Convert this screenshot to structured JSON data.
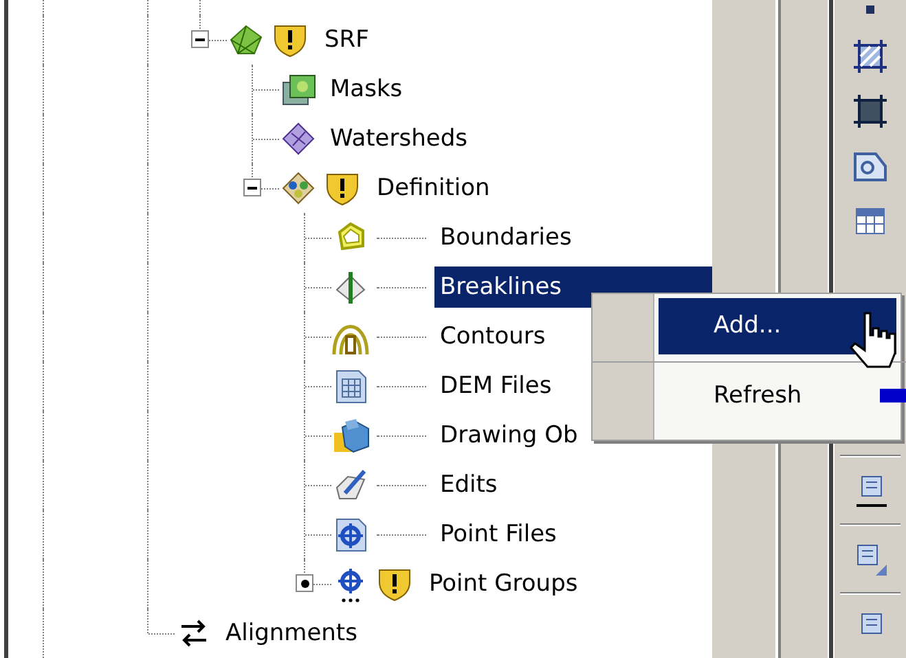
{
  "tree": [
    {
      "expanded": true,
      "children": [
        {
          "label": "SRF",
          "expanded": true,
          "warning": true,
          "selected": false,
          "children": [
            {
              "label": "Masks",
              "warning": false,
              "selected": false
            },
            {
              "label": "Watersheds",
              "warning": false,
              "selected": false
            },
            {
              "label": "Definition",
              "expanded": true,
              "warning": true,
              "selected": false,
              "children": [
                {
                  "label": "Boundaries",
                  "warning": false,
                  "selected": false
                },
                {
                  "label": "Breaklines",
                  "warning": false,
                  "selected": true
                },
                {
                  "label": "Contours",
                  "warning": false,
                  "selected": false
                },
                {
                  "label": "DEM Files",
                  "warning": false,
                  "selected": false
                },
                {
                  "label": "Drawing Ob",
                  "warning": false,
                  "selected": false
                },
                {
                  "label": "Edits",
                  "warning": false,
                  "selected": false
                },
                {
                  "label": "Point Files",
                  "warning": false,
                  "selected": false
                },
                {
                  "label": "Point Groups",
                  "expanded": false,
                  "warning": true,
                  "selected": false
                }
              ]
            }
          ]
        }
      ]
    },
    {
      "label": "Alignments",
      "warning": false,
      "selected": false
    }
  ],
  "context_menu": {
    "items": [
      {
        "label": "Add...",
        "selected": true
      },
      {
        "label": "Refresh",
        "selected": false
      }
    ]
  }
}
